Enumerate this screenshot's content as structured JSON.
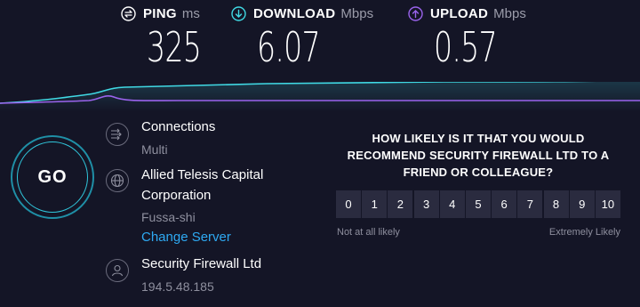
{
  "metrics": {
    "ping": {
      "label": "PING",
      "unit": "ms",
      "value": "325"
    },
    "download": {
      "label": "DOWNLOAD",
      "unit": "Mbps",
      "value": "6.07"
    },
    "upload": {
      "label": "UPLOAD",
      "unit": "Mbps",
      "value": "0.57"
    }
  },
  "go_label": "GO",
  "connections": {
    "title": "Connections",
    "value": "Multi"
  },
  "server": {
    "name_line1": "Allied Telesis Capital",
    "name_line2": "Corporation",
    "location": "Fussa-shi",
    "change_link": "Change Server"
  },
  "provider": {
    "name": "Security Firewall Ltd",
    "ip": "194.5.48.185"
  },
  "survey": {
    "question_line1": "HOW LIKELY IS IT THAT YOU WOULD",
    "question_line2": "RECOMMEND SECURITY FIREWALL LTD TO A",
    "question_line3": "FRIEND OR COLLEAGUE?",
    "scale": [
      "0",
      "1",
      "2",
      "3",
      "4",
      "5",
      "6",
      "7",
      "8",
      "9",
      "10"
    ],
    "low_label": "Not at all likely",
    "high_label": "Extremely Likely"
  },
  "colors": {
    "background": "#141526",
    "download": "#40d9e4",
    "upload": "#9a63ec",
    "ping": "#ffffff",
    "link": "#2ea9f2",
    "go_ring": "#30c6db"
  }
}
